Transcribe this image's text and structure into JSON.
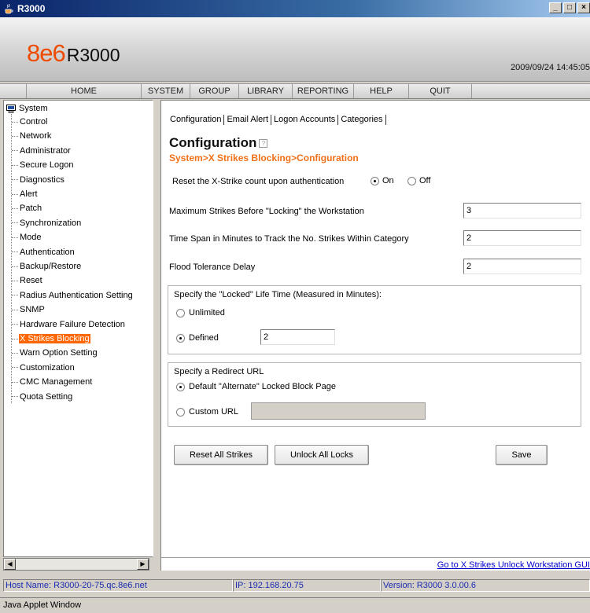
{
  "window": {
    "title": "R3000",
    "minimize": "_",
    "restore": "□",
    "close": "×"
  },
  "header": {
    "logo_8e6": "8e6",
    "logo_product": "R3000",
    "datetime": "2009/09/24 14:45:05"
  },
  "nav": [
    "HOME",
    "SYSTEM",
    "GROUP",
    "LIBRARY",
    "REPORTING",
    "HELP",
    "QUIT"
  ],
  "tree": {
    "root": "System",
    "items": [
      "Control",
      "Network",
      "Administrator",
      "Secure Logon",
      "Diagnostics",
      "Alert",
      "Patch",
      "Synchronization",
      "Mode",
      "Authentication",
      "Backup/Restore",
      "Reset",
      "Radius Authentication Setting",
      "SNMP",
      "Hardware Failure Detection",
      "X Strikes Blocking",
      "Warn Option Setting",
      "Customization",
      "CMC Management",
      "Quota Setting"
    ],
    "selected": "X Strikes Blocking"
  },
  "tabs": [
    "Configuration",
    "Email Alert",
    "Logon Accounts",
    "Categories"
  ],
  "page": {
    "title": "Configuration",
    "breadcrumb": "System>X Strikes Blocking>Configuration",
    "reset_label": "Reset the X-Strike count upon authentication",
    "reset_on": "On",
    "reset_off": "Off",
    "max_strikes_label": "Maximum Strikes Before \"Locking\" the Workstation",
    "max_strikes_value": "3",
    "time_span_label": "Time Span in Minutes to Track the No. Strikes Within Category",
    "time_span_value": "2",
    "flood_label": "Flood Tolerance Delay",
    "flood_value": "2",
    "locked_group_label": "Specify the \"Locked\" Life Time (Measured in Minutes):",
    "unlimited_label": "Unlimited",
    "defined_label": "Defined",
    "defined_value": "2",
    "redirect_group_label": "Specify a Redirect URL",
    "default_page_label": "Default \"Alternate\" Locked Block Page",
    "custom_url_label": "Custom URL",
    "custom_url_value": "",
    "reset_all_button": "Reset All Strikes",
    "unlock_all_button": "Unlock All Locks",
    "save_button": "Save",
    "unlock_link": "Go to X Strikes Unlock Workstation GUI"
  },
  "status": {
    "host": "Host Name: R3000-20-75.qc.8e6.net",
    "ip": "IP: 192.168.20.75",
    "version": "Version: R3000 3.0.00.6"
  },
  "applet_label": "Java Applet Window",
  "colors": {
    "accent_orange": "#ff6600",
    "breadcrumb_orange": "#f07018",
    "status_text": "#1a2bb0",
    "link": "#0000cc"
  }
}
